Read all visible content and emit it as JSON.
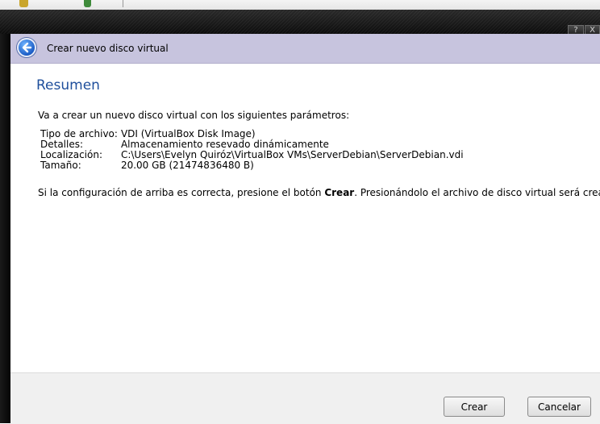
{
  "window": {
    "help_label": "?",
    "close_label": "X"
  },
  "header": {
    "title": "Crear nuevo disco virtual",
    "back_icon": "back-arrow-icon"
  },
  "content": {
    "section_title": "Resumen",
    "intro": "Va a crear un nuevo disco virtual con los siguientes parámetros:",
    "params": [
      {
        "key": "Tipo de archivo:",
        "value": "VDI (VirtualBox Disk Image)"
      },
      {
        "key": "Detalles:",
        "value": "Almacenamiento resevado dinámicamente"
      },
      {
        "key": "Localización:",
        "value": "C:\\Users\\Evelyn Quiróz\\VirtualBox VMs\\ServerDebian\\ServerDebian.vdi"
      },
      {
        "key": "Tamaño:",
        "value": "20.00 GB (21474836480 B)"
      }
    ],
    "note_pre": "Si la configuración de arriba es correcta, presione el botón ",
    "note_bold": "Crear",
    "note_post": ". Presionándolo el archivo de disco virtual será creado."
  },
  "footer": {
    "create_label": "Crear",
    "cancel_label": "Cancelar"
  }
}
